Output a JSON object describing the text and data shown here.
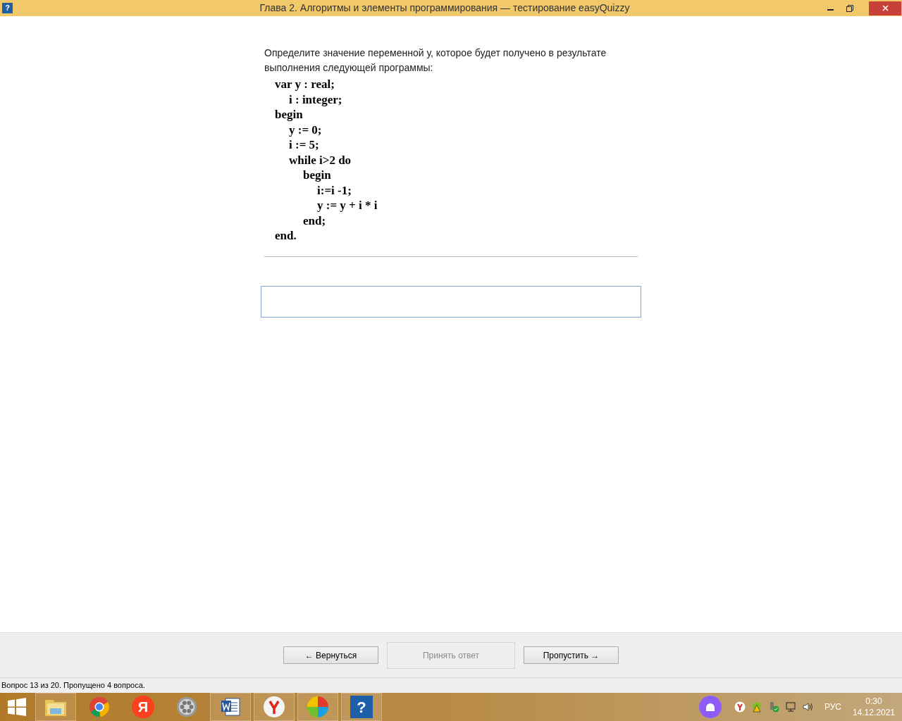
{
  "window": {
    "icon_glyph": "?",
    "title": "Глава 2. Алгоритмы и элементы программирования — тестирование easyQuizzy"
  },
  "question": {
    "text": "Определите значение переменной у, которое будет получено в результате выполнения следующей программы:",
    "code": [
      {
        "text": "var y : real;",
        "children": [
          {
            "text": "i : integer;"
          }
        ]
      },
      {
        "text": "begin",
        "children": [
          {
            "text": "y := 0;"
          },
          {
            "text": "i := 5;"
          },
          {
            "text": "while i>2 do",
            "children": [
              {
                "text": "begin",
                "children": [
                  {
                    "text": "i:=i -1;"
                  },
                  {
                    "text": "y := y + i * i"
                  }
                ]
              },
              {
                "text": "end;"
              }
            ]
          }
        ]
      },
      {
        "text": "end."
      }
    ]
  },
  "buttons": [
    {
      "label": "← Вернуться",
      "disabled": false
    },
    {
      "label": "Принять ответ",
      "disabled": true
    },
    {
      "label": "Пропустить →",
      "disabled": false
    }
  ],
  "status_bar": "Вопрос 13 из 20. Пропущено 4 вопроса.",
  "taskbar": {
    "apps": [
      {
        "kind": "start"
      },
      {
        "kind": "folder",
        "active": true
      },
      {
        "kind": "chrome",
        "active": false
      },
      {
        "kind": "yandex",
        "glyph": "Я",
        "active": false
      },
      {
        "kind": "film",
        "active": false
      },
      {
        "kind": "word",
        "active": true
      },
      {
        "kind": "ybrowser",
        "active": true
      },
      {
        "kind": "colorball",
        "active": true
      },
      {
        "kind": "quiz",
        "glyph": "?",
        "active": true
      }
    ],
    "language": "РУС",
    "time": "0:30",
    "date": "14.12.2021"
  }
}
